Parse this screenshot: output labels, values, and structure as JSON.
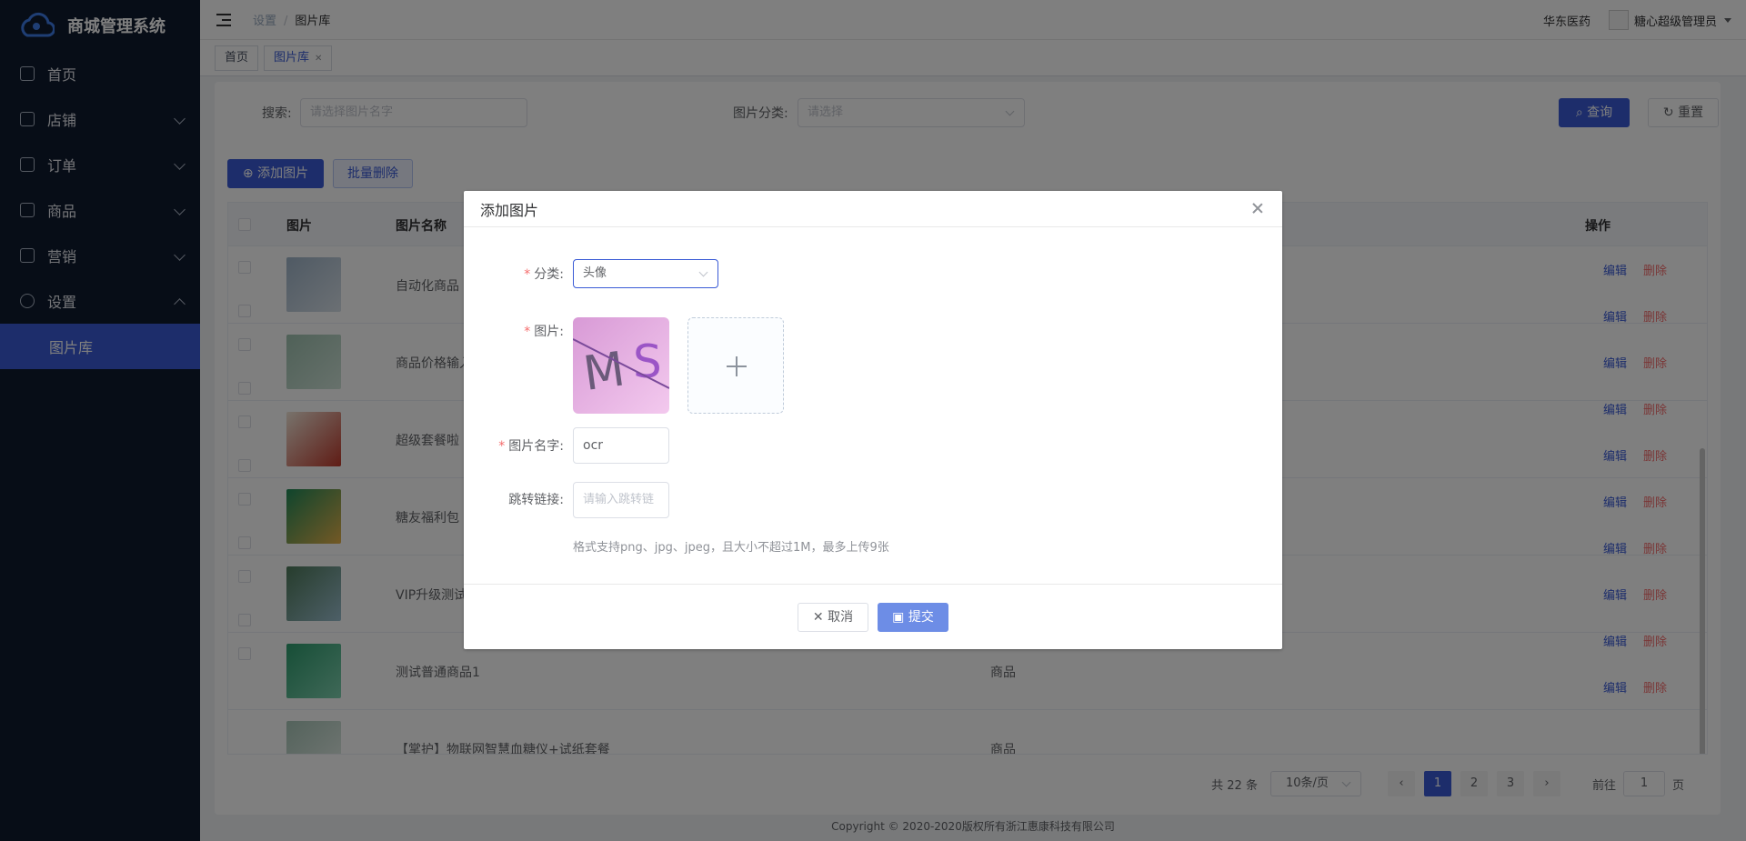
{
  "app": {
    "title": "商城管理系统"
  },
  "sidebar": {
    "items": [
      {
        "label": "首页",
        "icon": "home-icon"
      },
      {
        "label": "店铺",
        "icon": "store-icon"
      },
      {
        "label": "订单",
        "icon": "order-icon"
      },
      {
        "label": "商品",
        "icon": "goods-icon"
      },
      {
        "label": "营销",
        "icon": "marketing-icon"
      },
      {
        "label": "设置",
        "icon": "gear-icon"
      }
    ],
    "submenu": {
      "label": "图片库"
    }
  },
  "header": {
    "breadcrumb": [
      "设置",
      "图片库"
    ],
    "company": "华东医药",
    "user": "糖心超级管理员"
  },
  "tags": {
    "home": "首页",
    "current": "图片库"
  },
  "search": {
    "label": "搜索:",
    "placeholder": "请选择图片名字",
    "category_label": "图片分类:",
    "category_placeholder": "请选择",
    "query_button": "查询",
    "reset_button": "重置"
  },
  "toolbar": {
    "add_button": "添加图片",
    "batch_delete_button": "批量删除"
  },
  "table": {
    "columns": {
      "image": "图片",
      "name": "图片名称",
      "actions": "操作"
    },
    "rows": [
      {
        "name": "自动化商品"
      },
      {
        "name": "商品价格输入"
      },
      {
        "name": "超级套餐啦"
      },
      {
        "name": "糖友福利包"
      },
      {
        "name": "VIP升级测试"
      },
      {
        "name": "测试普通商品1",
        "category": "商品"
      },
      {
        "name": "【掌护】物联网智慧血糖仪+试纸套餐",
        "category": "商品"
      }
    ],
    "actions": {
      "edit": "编辑",
      "delete": "删除"
    }
  },
  "pagination": {
    "total": "共 22 条",
    "page_size": "10条/页",
    "pages": [
      "1",
      "2",
      "3"
    ],
    "current": "1",
    "goto_prefix": "前往",
    "goto_value": "1",
    "goto_suffix": "页"
  },
  "footer": {
    "copyright": "Copyright © 2020-2020版权所有浙江惠康科技有限公司"
  },
  "modal": {
    "title": "添加图片",
    "category_label": "分类:",
    "category_value": "头像",
    "image_label": "图片:",
    "name_label": "图片名字:",
    "name_value": "ocr",
    "link_label": "跳转链接:",
    "link_placeholder": "请输入跳转链",
    "hint": "格式支持png、jpg、jpeg，且大小不超过1M，最多上传9张",
    "cancel_button": "取消",
    "submit_button": "提交"
  },
  "colors": {
    "primary": "#3a5bd6",
    "sidebar": "#0f1a2e",
    "danger": "#f56c6c"
  }
}
